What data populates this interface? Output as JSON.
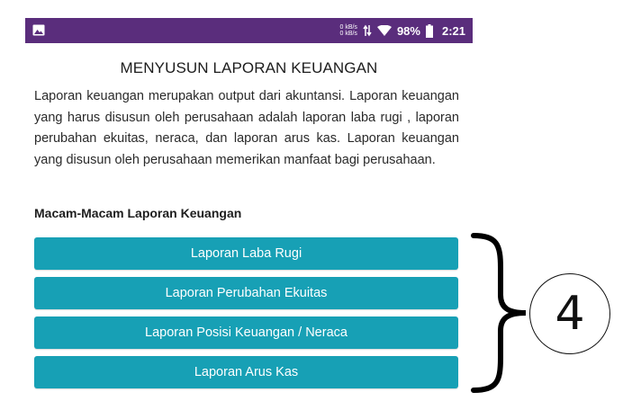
{
  "status_bar": {
    "speed_up": "0 kB/s",
    "speed_down": "0 kB/s",
    "battery_percent": "98%",
    "time": "2:21",
    "icons": [
      "image-icon",
      "data-arrows-icon",
      "wifi-icon",
      "battery-icon"
    ],
    "background_color": "#5a2d7c"
  },
  "page": {
    "title": "MENYUSUN LAPORAN KEUANGAN",
    "paragraph": "Laporan keuangan merupakan output dari akuntansi. Laporan keuangan yang harus disusun oleh perusahaan adalah laporan laba rugi , laporan perubahan ekuitas, neraca, dan laporan arus kas. Laporan keuangan yang disusun oleh perusahaan memerikan manfaat bagi perusahaan.",
    "subheading": "Macam-Macam Laporan Keuangan"
  },
  "buttons": [
    {
      "label": "Laporan Laba Rugi"
    },
    {
      "label": "Laporan Perubahan Ekuitas"
    },
    {
      "label": "Laporan Posisi Keuangan / Neraca"
    },
    {
      "label": "Laporan Arus Kas"
    }
  ],
  "button_color": "#17a0b5",
  "annotation": {
    "number": "4"
  }
}
